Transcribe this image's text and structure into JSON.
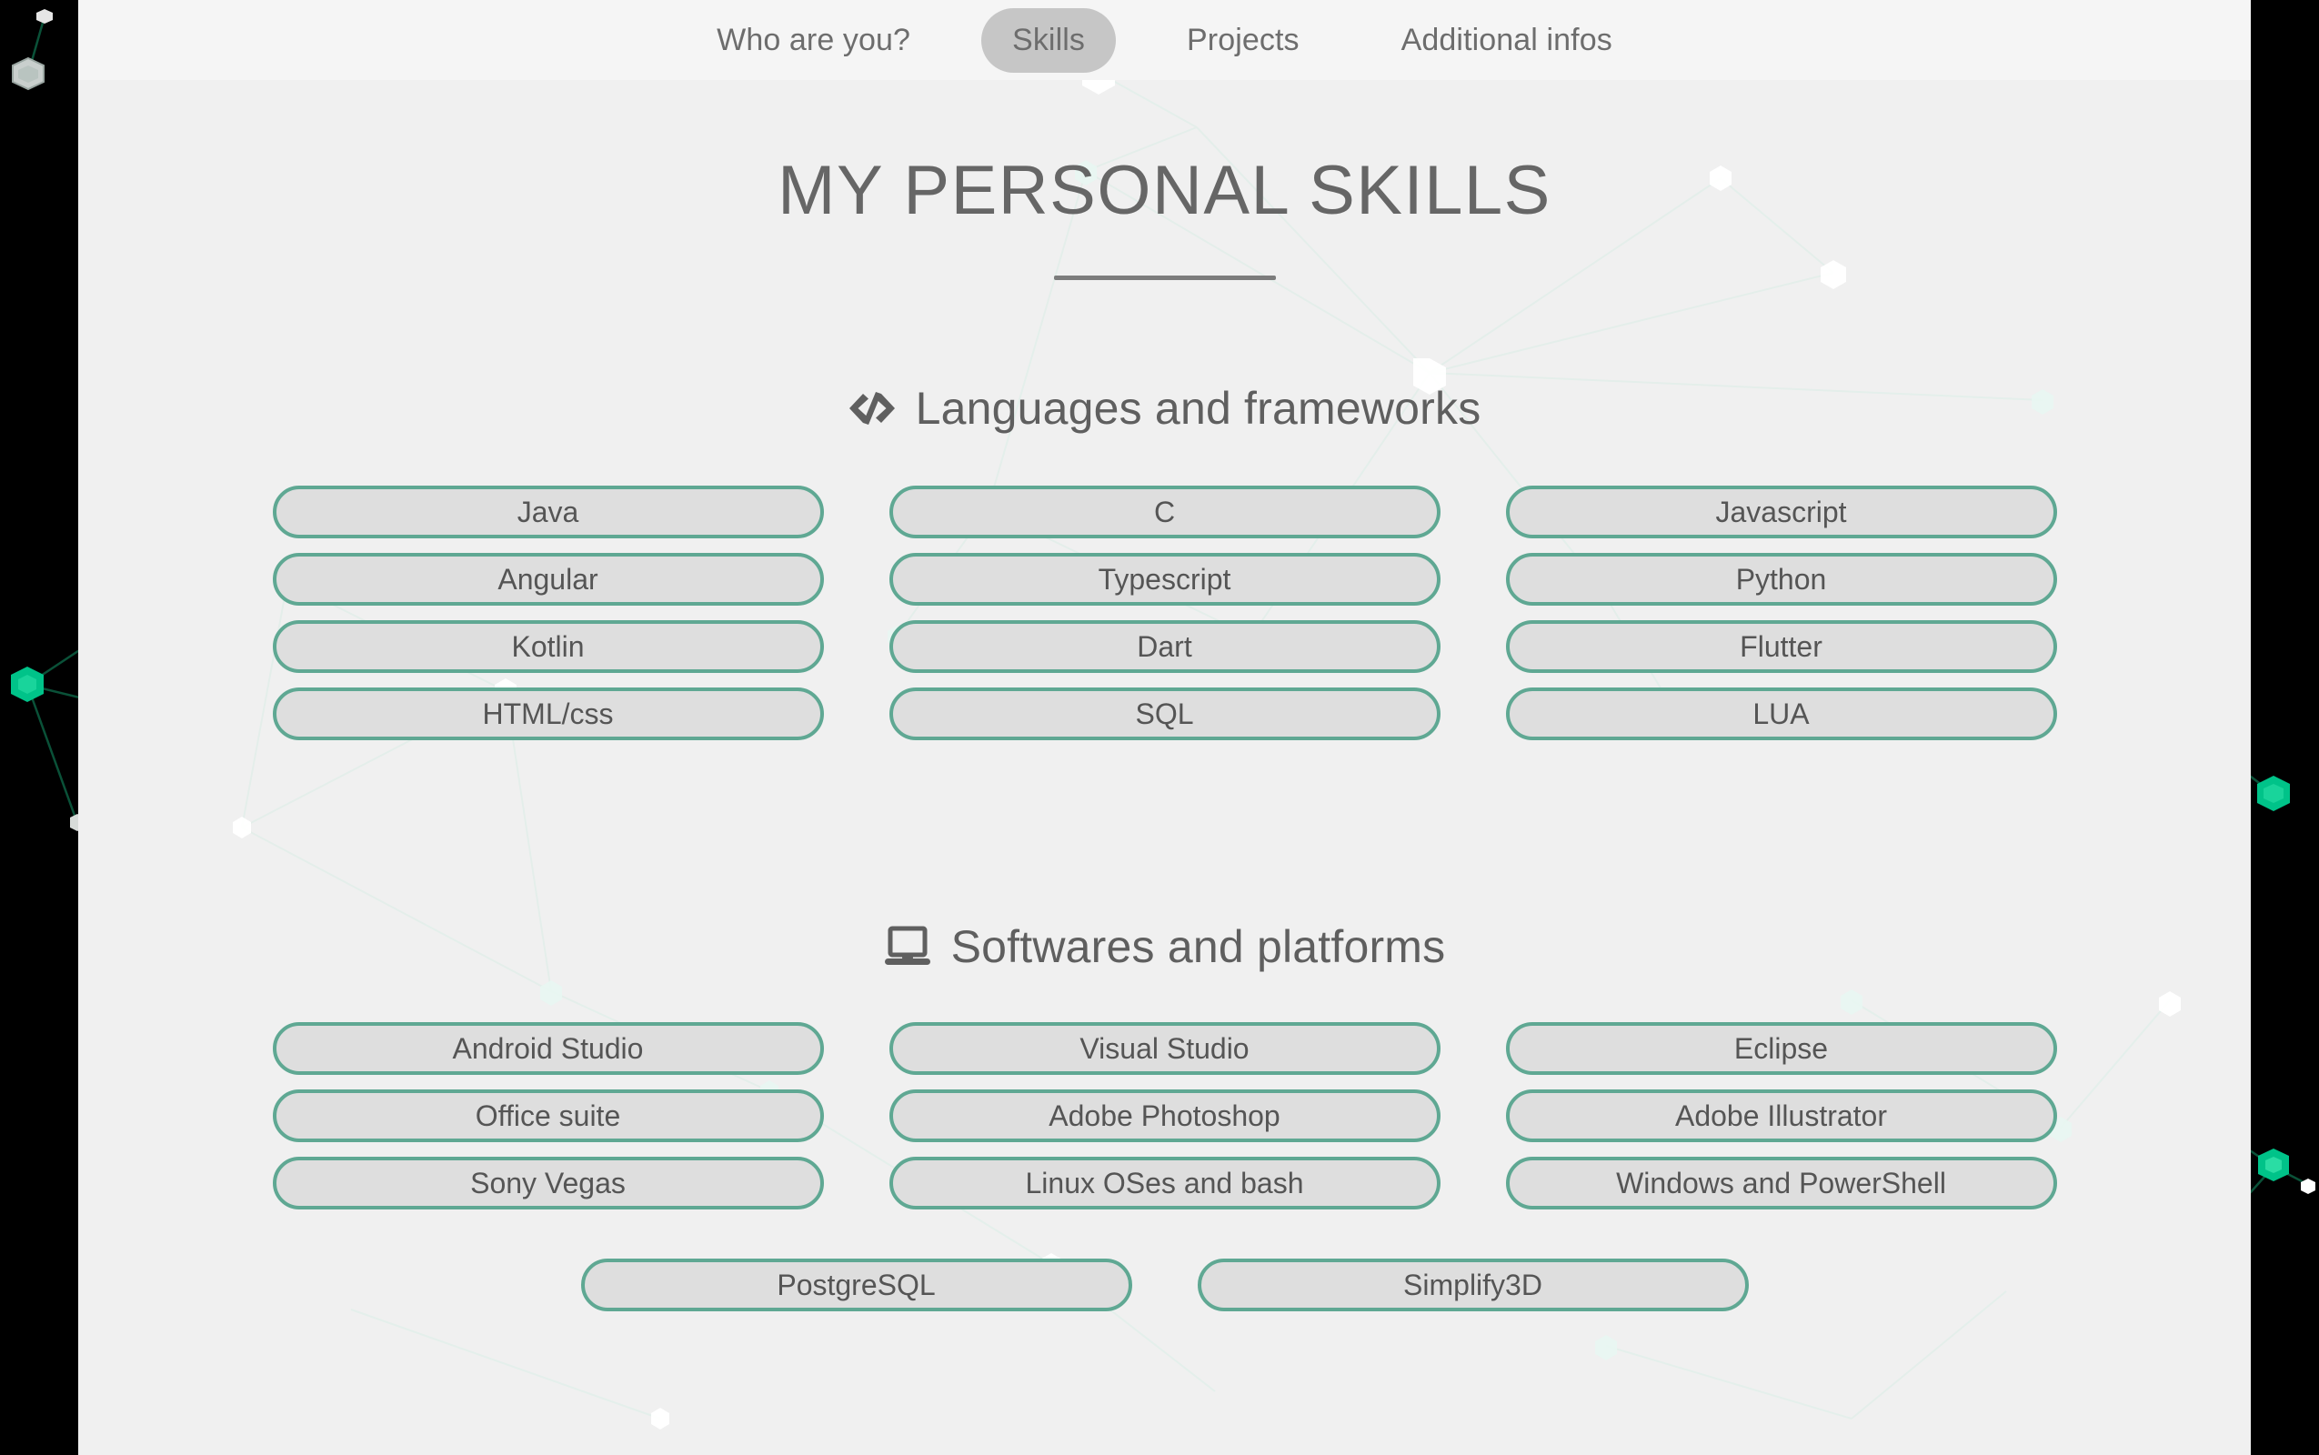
{
  "theme": {
    "page_background": "#f0f0f0",
    "navbar_background": "#f5f5f5",
    "side_panel_background": "#000000",
    "accent_border": "#5fa893",
    "pill_fill": "#dedede",
    "text_color": "#5f5f5f",
    "active_tab_background": "#c6c6c6",
    "particle_green": "#00c389"
  },
  "nav": {
    "items": [
      {
        "label": "Who are you?",
        "active": false
      },
      {
        "label": "Skills",
        "active": true
      },
      {
        "label": "Projects",
        "active": false
      },
      {
        "label": "Additional infos",
        "active": false
      }
    ]
  },
  "header": {
    "title": "MY PERSONAL SKILLS"
  },
  "sections": [
    {
      "id": "languages",
      "icon": "code-icon",
      "heading": "Languages and frameworks",
      "columns": [
        [
          "Java",
          "Angular",
          "Kotlin",
          "HTML/css"
        ],
        [
          "C",
          "Typescript",
          "Dart",
          "SQL"
        ],
        [
          "Javascript",
          "Python",
          "Flutter",
          "LUA"
        ]
      ],
      "pills": [
        "Java",
        "C",
        "Javascript",
        "Angular",
        "Typescript",
        "Python",
        "Kotlin",
        "Dart",
        "Flutter",
        "HTML/css",
        "SQL",
        "LUA"
      ],
      "extra_row": []
    },
    {
      "id": "software",
      "icon": "laptop-icon",
      "heading": "Softwares and platforms",
      "columns": [
        [
          "Android Studio",
          "Office suite",
          "Sony Vegas"
        ],
        [
          "Visual Studio",
          "Adobe Photoshop",
          "Linux OSes and bash"
        ],
        [
          "Eclipse",
          "Adobe Illustrator",
          "Windows and PowerShell"
        ]
      ],
      "pills": [
        "Android Studio",
        "Visual Studio",
        "Eclipse",
        "Office suite",
        "Adobe Photoshop",
        "Adobe Illustrator",
        "Sony Vegas",
        "Linux OSes and bash",
        "Windows and PowerShell"
      ],
      "extra_row": [
        "PostgreSQL",
        "Simplify3D"
      ]
    }
  ]
}
